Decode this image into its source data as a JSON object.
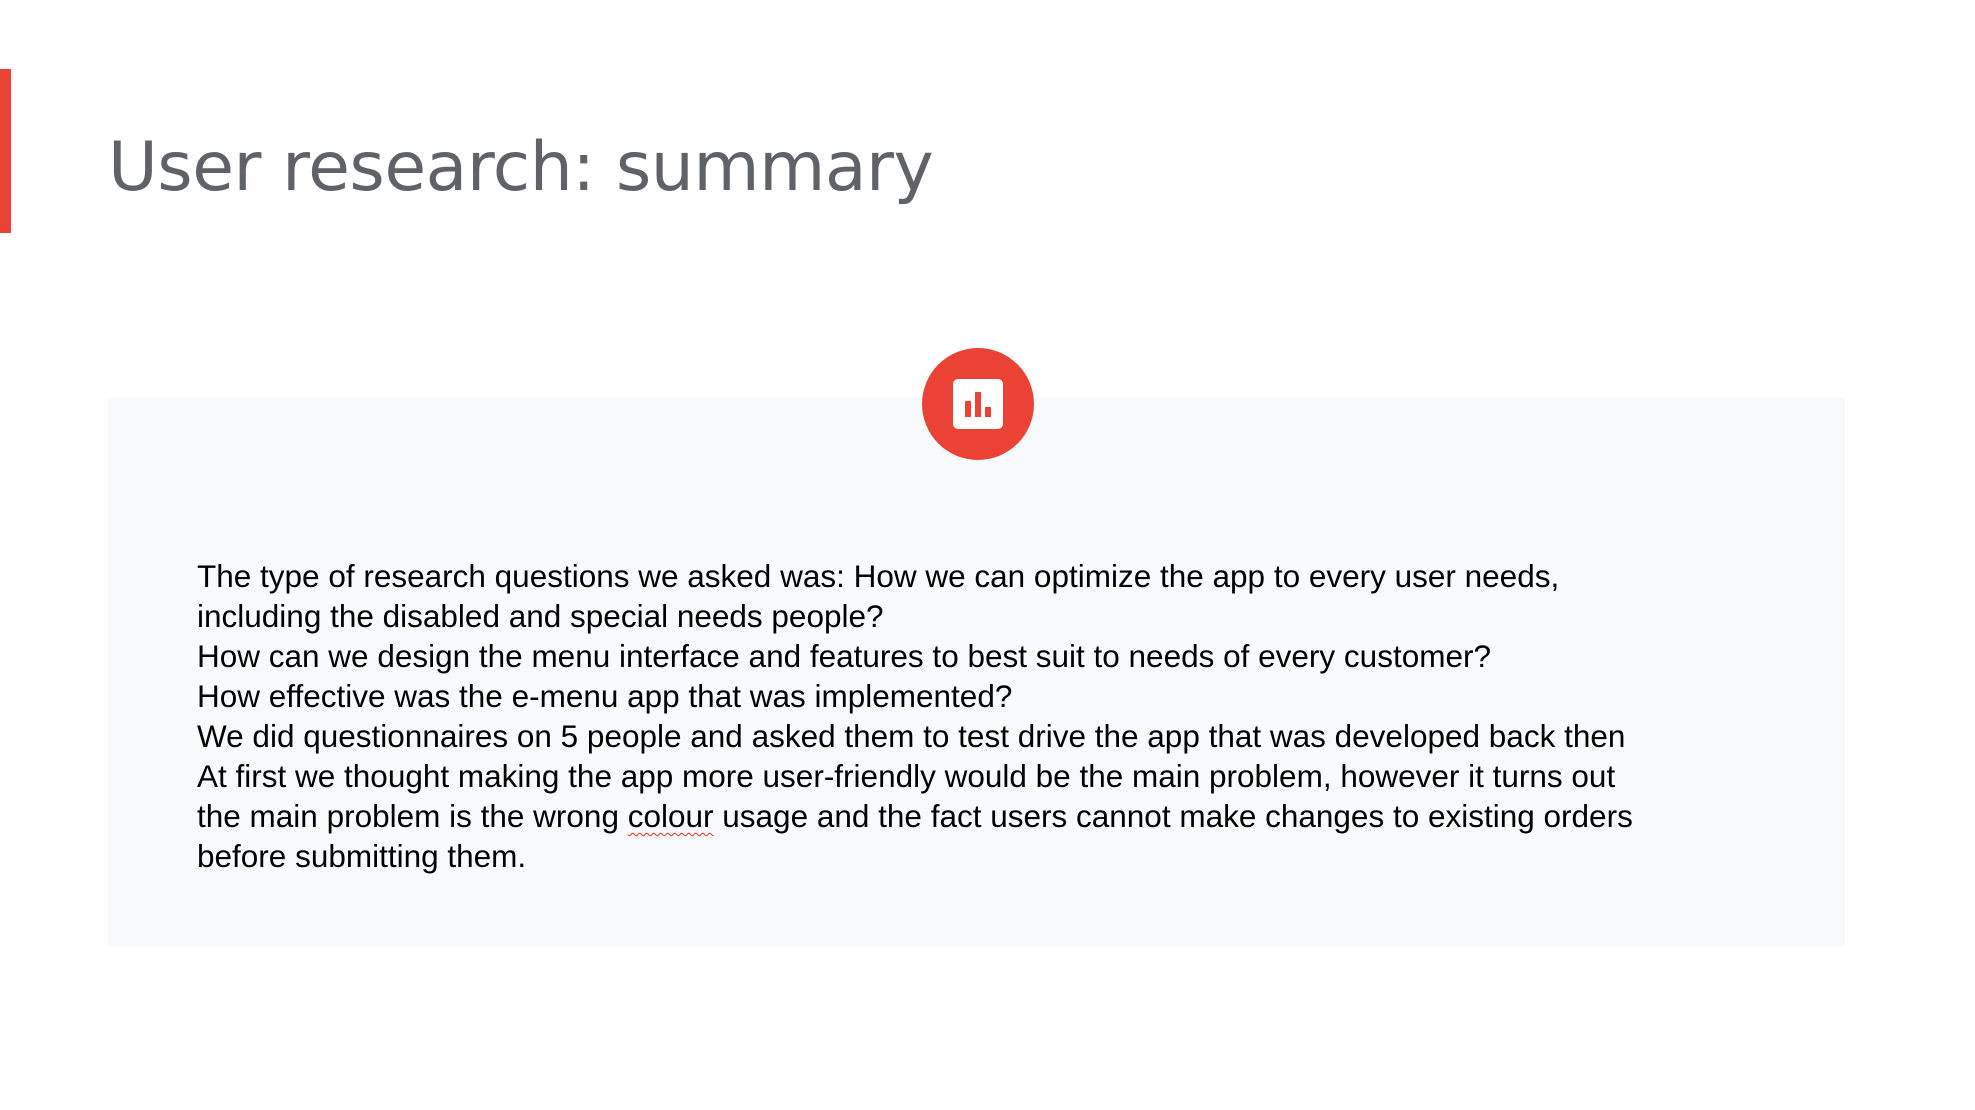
{
  "slide": {
    "title": "User research: summary",
    "accent_color": "#ea4335",
    "icon": "bar-chart-icon",
    "body_lines": [
      "The type of research questions we asked was: How we can optimize the app to every user needs,",
      "including the disabled and special needs people?",
      "How can we design the menu interface and features to best suit to needs of every customer?",
      "How effective was the e-menu app that was implemented?",
      "We did questionnaires on 5 people and asked them to test drive the app that was developed back then",
      "At first we thought making the app more user-friendly would be the main problem, however it turns out"
    ],
    "line_7_before": "the main problem is the wrong ",
    "line_7_misspelled": "colour",
    "line_7_after": " usage and the fact users cannot make changes to existing orders",
    "line_8": "before submitting them."
  }
}
